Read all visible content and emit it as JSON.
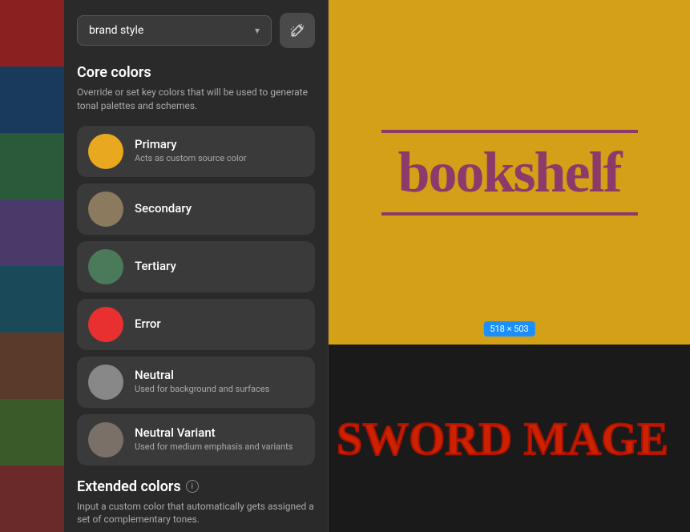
{
  "toolbar": {
    "dropdown_label": "brand style",
    "chevron": "▾",
    "magic_button_label": "magic"
  },
  "core_colors": {
    "title": "Core colors",
    "description": "Override or set key colors that will be used to generate tonal palettes and schemes.",
    "items": [
      {
        "id": "primary",
        "name": "Primary",
        "desc": "Acts as custom source color",
        "swatch_color": "#E8A820"
      },
      {
        "id": "secondary",
        "name": "Secondary",
        "desc": "",
        "swatch_color": "#8B7A5E"
      },
      {
        "id": "tertiary",
        "name": "Tertiary",
        "desc": "",
        "swatch_color": "#4A7A5A"
      },
      {
        "id": "error",
        "name": "Error",
        "desc": "",
        "swatch_color": "#E83030"
      },
      {
        "id": "neutral",
        "name": "Neutral",
        "desc": "Used for background and surfaces",
        "swatch_color": "#888888"
      },
      {
        "id": "neutral-variant",
        "name": "Neutral Variant",
        "desc": "Used for medium emphasis and variants",
        "swatch_color": "#7A7068"
      }
    ]
  },
  "extended_colors": {
    "title": "Extended colors",
    "info_icon": "i",
    "description": "Input a custom color that automatically gets assigned a set of complementary tones."
  },
  "preview": {
    "bookshelf_text": "bookshelf",
    "size_badge": "518 × 503",
    "sword_text": "SWORD MAGE"
  },
  "book_spines": [
    "spine-1",
    "spine-2",
    "spine-3",
    "spine-4",
    "spine-5",
    "spine-6",
    "spine-7",
    "spine-8"
  ]
}
